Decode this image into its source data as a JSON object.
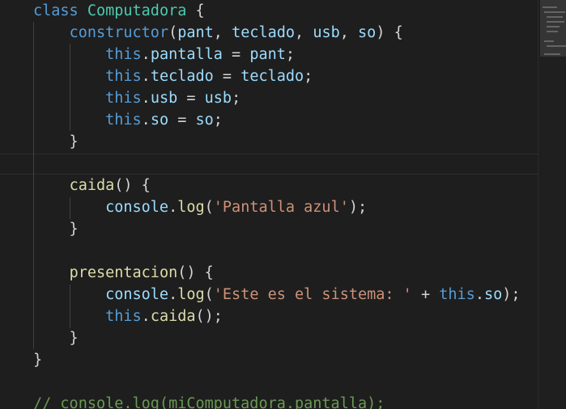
{
  "editor": {
    "language": "javascript",
    "lines": [
      [
        {
          "t": "kw",
          "v": "class"
        },
        {
          "t": "pun",
          "v": " "
        },
        {
          "t": "cls",
          "v": "Computadora"
        },
        {
          "t": "pun",
          "v": " {"
        }
      ],
      [
        {
          "t": "pun",
          "v": "    "
        },
        {
          "t": "kw",
          "v": "constructor"
        },
        {
          "t": "pun",
          "v": "("
        },
        {
          "t": "var",
          "v": "pant"
        },
        {
          "t": "pun",
          "v": ", "
        },
        {
          "t": "var",
          "v": "teclado"
        },
        {
          "t": "pun",
          "v": ", "
        },
        {
          "t": "var",
          "v": "usb"
        },
        {
          "t": "pun",
          "v": ", "
        },
        {
          "t": "var",
          "v": "so"
        },
        {
          "t": "pun",
          "v": ") {"
        }
      ],
      [
        {
          "t": "pun",
          "v": "        "
        },
        {
          "t": "kw",
          "v": "this"
        },
        {
          "t": "pun",
          "v": "."
        },
        {
          "t": "var",
          "v": "pantalla"
        },
        {
          "t": "pun",
          "v": " = "
        },
        {
          "t": "var",
          "v": "pant"
        },
        {
          "t": "pun",
          "v": ";"
        }
      ],
      [
        {
          "t": "pun",
          "v": "        "
        },
        {
          "t": "kw",
          "v": "this"
        },
        {
          "t": "pun",
          "v": "."
        },
        {
          "t": "var",
          "v": "teclado"
        },
        {
          "t": "pun",
          "v": " = "
        },
        {
          "t": "var",
          "v": "teclado"
        },
        {
          "t": "pun",
          "v": ";"
        }
      ],
      [
        {
          "t": "pun",
          "v": "        "
        },
        {
          "t": "kw",
          "v": "this"
        },
        {
          "t": "pun",
          "v": "."
        },
        {
          "t": "var",
          "v": "usb"
        },
        {
          "t": "pun",
          "v": " = "
        },
        {
          "t": "var",
          "v": "usb"
        },
        {
          "t": "pun",
          "v": ";"
        }
      ],
      [
        {
          "t": "pun",
          "v": "        "
        },
        {
          "t": "kw",
          "v": "this"
        },
        {
          "t": "pun",
          "v": "."
        },
        {
          "t": "var",
          "v": "so"
        },
        {
          "t": "pun",
          "v": " = "
        },
        {
          "t": "var",
          "v": "so"
        },
        {
          "t": "pun",
          "v": ";"
        }
      ],
      [
        {
          "t": "pun",
          "v": "    }"
        }
      ],
      [],
      [
        {
          "t": "pun",
          "v": "    "
        },
        {
          "t": "fn",
          "v": "caida"
        },
        {
          "t": "pun",
          "v": "() {"
        }
      ],
      [
        {
          "t": "pun",
          "v": "        "
        },
        {
          "t": "var",
          "v": "console"
        },
        {
          "t": "pun",
          "v": "."
        },
        {
          "t": "fn",
          "v": "log"
        },
        {
          "t": "pun",
          "v": "("
        },
        {
          "t": "str",
          "v": "'Pantalla azul'"
        },
        {
          "t": "pun",
          "v": ");"
        }
      ],
      [
        {
          "t": "pun",
          "v": "    }"
        }
      ],
      [],
      [
        {
          "t": "pun",
          "v": "    "
        },
        {
          "t": "fn",
          "v": "presentacion"
        },
        {
          "t": "pun",
          "v": "() {"
        }
      ],
      [
        {
          "t": "pun",
          "v": "        "
        },
        {
          "t": "var",
          "v": "console"
        },
        {
          "t": "pun",
          "v": "."
        },
        {
          "t": "fn",
          "v": "log"
        },
        {
          "t": "pun",
          "v": "("
        },
        {
          "t": "str",
          "v": "'Este es el sistema: '"
        },
        {
          "t": "pun",
          "v": " + "
        },
        {
          "t": "kw",
          "v": "this"
        },
        {
          "t": "pun",
          "v": "."
        },
        {
          "t": "var",
          "v": "so"
        },
        {
          "t": "pun",
          "v": ");"
        }
      ],
      [
        {
          "t": "pun",
          "v": "        "
        },
        {
          "t": "kw",
          "v": "this"
        },
        {
          "t": "pun",
          "v": "."
        },
        {
          "t": "fn",
          "v": "caida"
        },
        {
          "t": "pun",
          "v": "();"
        }
      ],
      [
        {
          "t": "pun",
          "v": "    }"
        }
      ],
      [
        {
          "t": "pun",
          "v": "}"
        }
      ],
      [],
      [
        {
          "t": "cmt",
          "v": "// console.log(miComputadora.pantalla);"
        }
      ]
    ]
  },
  "colors": {
    "background": "#1e1e1e",
    "keyword": "#569cd6",
    "class": "#4ec9b0",
    "function": "#dcdcaa",
    "variable": "#9cdcfe",
    "string": "#ce9178",
    "comment": "#6a9955"
  }
}
